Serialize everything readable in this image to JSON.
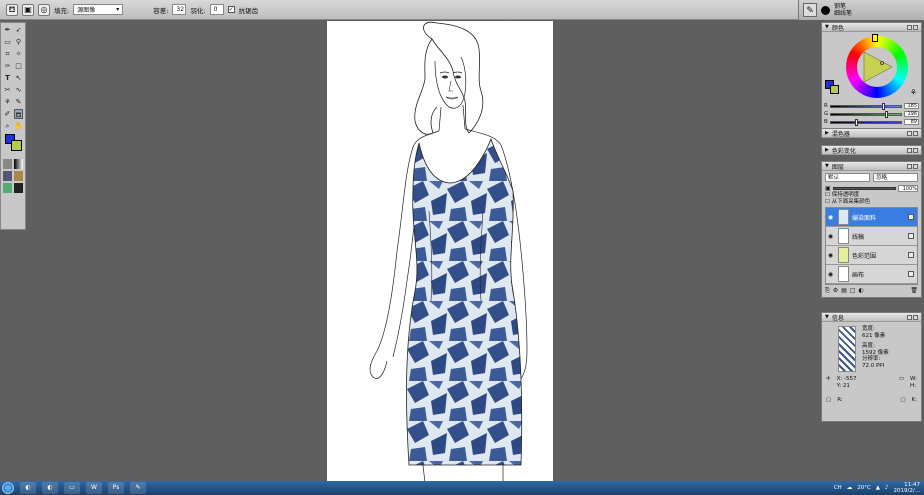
{
  "toolbar": {
    "fill_label": "填充:",
    "fill_value": "源图像",
    "tolerance_label": "容差:",
    "tolerance_value": "32",
    "feather_label": "羽化:",
    "feather_value": "0",
    "antialias_label": "抗锯齿"
  },
  "brush": {
    "name1": "钢笔",
    "name2": "细线笔"
  },
  "color_panel": {
    "title": "颜色",
    "r_label": "R",
    "g_label": "G",
    "b_label": "B",
    "r_value": "185",
    "g_value": "196",
    "b_value": "89",
    "r_fraction": 0.73,
    "g_fraction": 0.77,
    "b_fraction": 0.35
  },
  "mixer_panel": {
    "title": "混色器"
  },
  "variation_panel": {
    "title": "色彩变化"
  },
  "layers_panel": {
    "title": "图层",
    "mode": "默认",
    "blend": "忽略",
    "opacity": "100%",
    "option1": "保持透明度",
    "option2": "从下面采集颜色",
    "items": [
      {
        "name": "编染面料",
        "selected": true
      },
      {
        "name": "线稿",
        "selected": false
      },
      {
        "name": "色彩范围",
        "selected": false
      },
      {
        "name": "画布",
        "selected": false
      }
    ]
  },
  "info_panel": {
    "title": "信息",
    "width_label": "宽度:",
    "width_value": "621 像素",
    "height_label": "高度:",
    "height_value": "1592 像素",
    "resolution_label": "分辨率:",
    "resolution_value": "72.0 PPI",
    "x_value": "X: -557",
    "y_value": "Y: 21",
    "w_label": "W:",
    "h_label": "H:",
    "r_label": "R:",
    "k_label": "K:"
  },
  "taskbar": {
    "lang": "CH",
    "temp": "20°C",
    "time": "11:47",
    "date": "2019/2/..."
  }
}
